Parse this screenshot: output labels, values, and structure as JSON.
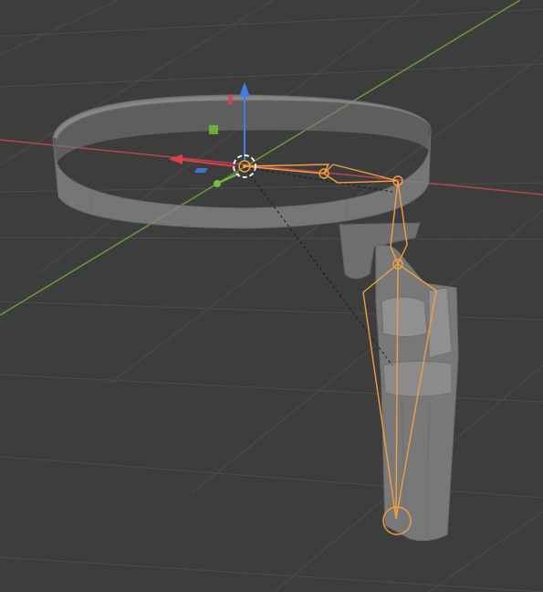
{
  "viewport": {
    "background": "#3d3d3d",
    "grid_color": "#4c4c4c"
  },
  "axes": {
    "x_axis_color": "#b8444f",
    "y_axis_color": "#6a9a35"
  },
  "objects": {
    "mesh_color": "#8c8c8c",
    "mesh_edge_color": "#6e6e6e",
    "armature_color": "#f0a040",
    "selected_icon": "armature-bones",
    "mesh_icon": "ring-and-cylinder-mesh"
  },
  "gizmo": {
    "z_arrow_color": "#3d7fe6",
    "x_arrow_color": "#e0404a",
    "y_dot_color": "#6fbf3a",
    "plane_xz_color": "#6fbf3a",
    "plane_yz_color": "#e0404a",
    "plane_xy_color": "#3d7fe6",
    "pivot_color": "#f0f0f0",
    "origin_color": "#f0a040"
  }
}
